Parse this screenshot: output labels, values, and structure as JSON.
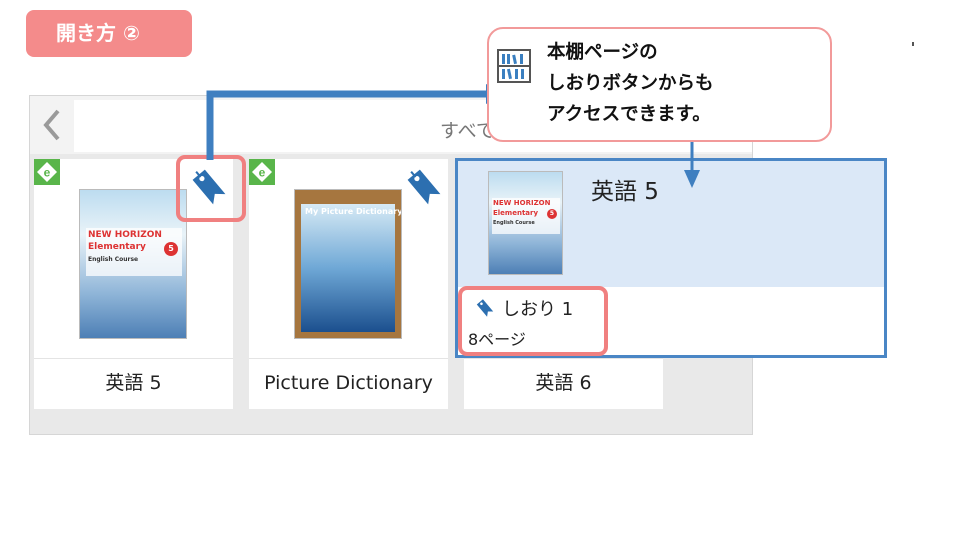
{
  "step_badge": "開き方 ②",
  "callout": {
    "lines": [
      "本棚ページの",
      "しおりボタンからも",
      "アクセスできます。"
    ],
    "icon": "bookshelf-icon"
  },
  "toolbar": {
    "back_icon": "chevron-left-icon",
    "filter_label": "すべて"
  },
  "books": [
    {
      "title": "英語 5",
      "cover_text": [
        "NEW HORIZON",
        "Elementary",
        "English Course",
        "5"
      ]
    },
    {
      "title": "Picture Dictionary",
      "cover_text": [
        "My Picture Dictionary"
      ]
    },
    {
      "title": "英語 6"
    }
  ],
  "detail": {
    "title": "英語 5",
    "bookmark_label": "しおり 1",
    "page_label": "8ページ",
    "cover_text": [
      "NEW HORIZON",
      "Elementary",
      "English Course",
      "5"
    ]
  },
  "colors": {
    "badge": "#f48b8b",
    "highlight": "#f08080",
    "panel_border": "#4a86c5",
    "panel_head": "#dbe8f7",
    "bookmark_icon": "#2c6fb0",
    "e_icon": "#59b54a"
  }
}
